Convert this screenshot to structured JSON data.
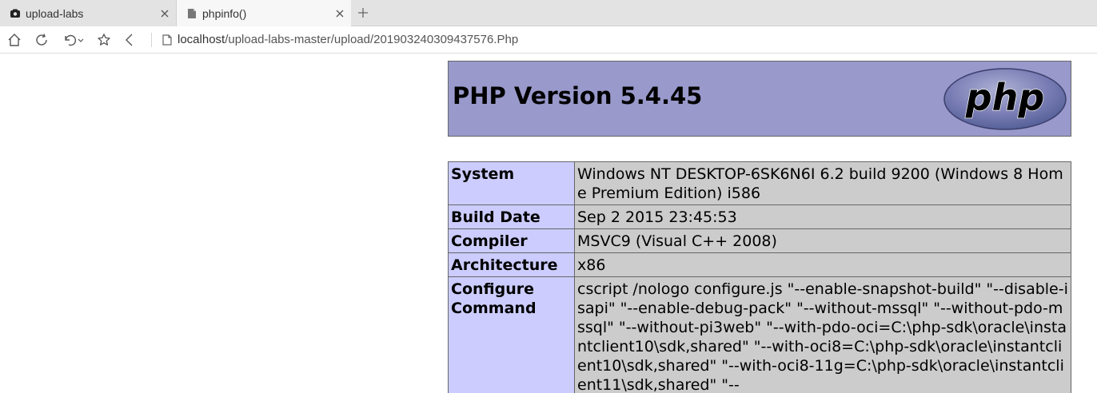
{
  "tabs": [
    {
      "title": "upload-labs",
      "icon": "cloud-icon",
      "active": false
    },
    {
      "title": "phpinfo()",
      "icon": "page-icon",
      "active": true
    }
  ],
  "toolbar": {
    "url_host": "localhost",
    "url_path": "/upload-labs-master/upload/201903240309437576.Php"
  },
  "php": {
    "version_title": "PHP Version 5.4.45",
    "logo_text": "php",
    "rows": [
      {
        "key": "System",
        "value": "Windows NT DESKTOP-6SK6N6I 6.2 build 9200 (Windows 8 Home Premium Edition) i586"
      },
      {
        "key": "Build Date",
        "value": "Sep 2 2015 23:45:53"
      },
      {
        "key": "Compiler",
        "value": "MSVC9 (Visual C++ 2008)"
      },
      {
        "key": "Architecture",
        "value": "x86"
      },
      {
        "key": "Configure Command",
        "value": "cscript /nologo configure.js \"--enable-snapshot-build\" \"--disable-isapi\" \"--enable-debug-pack\" \"--without-mssql\" \"--without-pdo-mssql\" \"--without-pi3web\" \"--with-pdo-oci=C:\\php-sdk\\oracle\\instantclient10\\sdk,shared\" \"--with-oci8=C:\\php-sdk\\oracle\\instantclient10\\sdk,shared\" \"--with-oci8-11g=C:\\php-sdk\\oracle\\instantclient11\\sdk,shared\" \"--"
      }
    ]
  },
  "colors": {
    "header_bg": "#9999cc",
    "key_bg": "#ccccff",
    "value_bg": "#cccccc",
    "border": "#666666"
  }
}
